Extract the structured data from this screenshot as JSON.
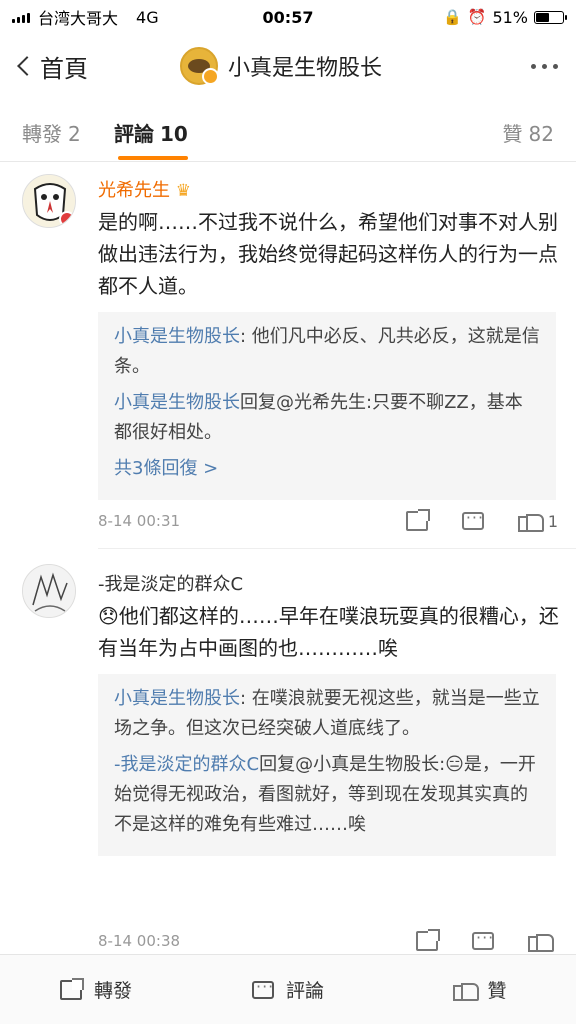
{
  "status_bar": {
    "carrier": "台湾大哥大",
    "network": "4G",
    "time": "00:57",
    "battery": "51%",
    "battery_level": 0.51
  },
  "nav": {
    "back_label": "首頁",
    "title": "小真是生物股长"
  },
  "tabs": {
    "repost_label": "轉發",
    "repost_count": "2",
    "comment_label": "評論",
    "comment_count": "10",
    "like_label": "贊",
    "like_count": "82"
  },
  "comments": [
    {
      "name": "光希先生",
      "body": "是的啊……不过我不说什么，希望他们对事不对人别做出违法行为，我始终觉得起码这样伤人的行为一点都不人道。",
      "replies": [
        {
          "who": "小真是生物股长",
          "text": ": 他们凡中必反、凡共必反，这就是信条。"
        },
        {
          "who": "小真是生物股长",
          "text": "回复@光希先生:只要不聊ZZ，基本都很好相处。"
        }
      ],
      "more_replies": "共3條回復 >",
      "time": "8-14 00:31",
      "like_count": "1"
    },
    {
      "name": "-我是淡定的群众C",
      "body": "😞他们都这样的……早年在噗浪玩耍真的很糟心，还有当年为占中画图的也…………唉",
      "replies": [
        {
          "who": "小真是生物股长",
          "text": ": 在噗浪就要无视这些，就当是一些立场之争。但这次已经突破人道底线了。"
        },
        {
          "who": "-我是淡定的群众C",
          "text": "回复@小真是生物股长:😑是，一开始觉得无视政治，看图就好，等到现在发现其实真的不是这样的难免有些难过……唉"
        }
      ],
      "time": "8-14 00:38",
      "like_count": ""
    }
  ],
  "bottom_bar": {
    "repost": "轉發",
    "comment": "評論",
    "like": "贊"
  },
  "colors": {
    "accent": "#ff8200",
    "link": "#507daf",
    "username": "#f06b00"
  }
}
